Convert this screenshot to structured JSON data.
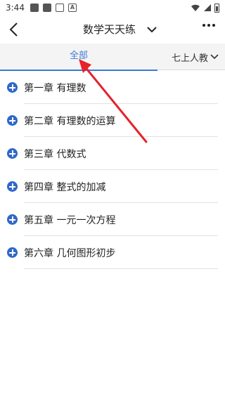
{
  "status_bar": {
    "time": "3:44",
    "notification_letter": "A"
  },
  "header": {
    "title": "数学天天练"
  },
  "tabs": {
    "all_label": "全部",
    "grade_label": "七上人教"
  },
  "chapters": [
    {
      "label": "第一章 有理数"
    },
    {
      "label": "第二章 有理数的运算"
    },
    {
      "label": "第三章 代数式"
    },
    {
      "label": "第四章 整式的加减"
    },
    {
      "label": "第五章 一元一次方程"
    },
    {
      "label": "第六章 几何图形初步"
    }
  ],
  "colors": {
    "accent": "#3a7ad6",
    "plus_icon": "#2f68c8",
    "arrow": "#e5232b"
  },
  "icons": [
    "back-arrow-icon",
    "chevron-down-icon",
    "more-icon",
    "plus-circle-icon",
    "wifi-icon",
    "signal-icon",
    "battery-icon"
  ]
}
